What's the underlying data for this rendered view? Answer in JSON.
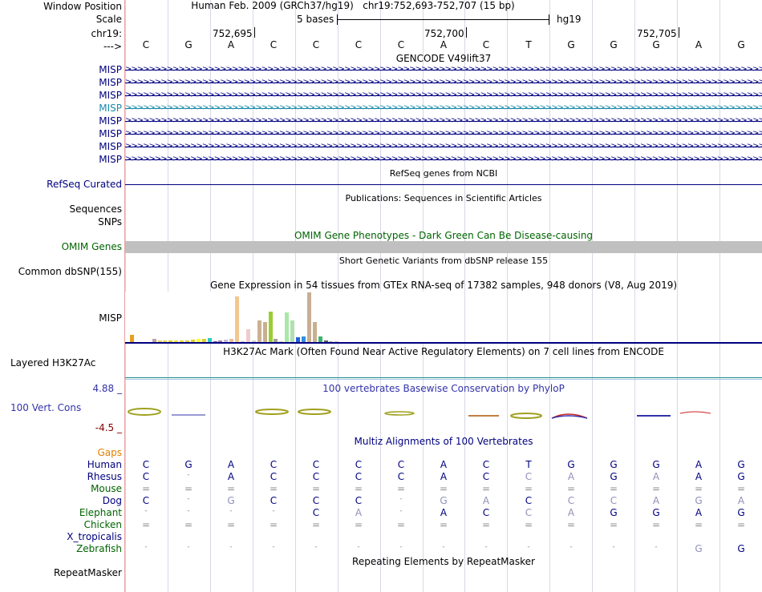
{
  "header": {
    "window_position_label": "Window Position",
    "scale_label": "Scale",
    "chrom_label": "chr19:",
    "strand_label": "--->",
    "assembly": "Human Feb. 2009 (GRCh37/hg19)",
    "position": "chr19:752,693-752,707 (15 bp)",
    "scale_text": "5 bases",
    "scale_db": "hg19",
    "ticks": [
      "752,695",
      "752,700",
      "752,705"
    ]
  },
  "bases": [
    "C",
    "G",
    "A",
    "C",
    "C",
    "C",
    "C",
    "A",
    "C",
    "T",
    "G",
    "G",
    "G",
    "A",
    "G"
  ],
  "gencode": {
    "title": "GENCODE V49lift37",
    "transcripts": [
      "MISP",
      "MISP",
      "MISP",
      "MISP",
      "MISP",
      "MISP",
      "MISP",
      "MISP"
    ]
  },
  "refseq": {
    "title": "RefSeq genes from NCBI",
    "label": "RefSeq Curated"
  },
  "publications": {
    "title": "Publications: Sequences in Scientific Articles",
    "label1": "Sequences",
    "label2": "SNPs"
  },
  "omim": {
    "title": "OMIM Gene Phenotypes - Dark Green Can Be Disease-causing",
    "label": "OMIM Genes"
  },
  "dbsnp": {
    "title": "Short Genetic Variants from dbSNP release 155",
    "label": "Common dbSNP(155)"
  },
  "gtex": {
    "title": "Gene Expression in 54 tissues from GTEx RNA-seq of 17382 samples, 948 donors (V8, Aug 2019)",
    "label": "MISP",
    "bars": [
      {
        "c": "#e7a020",
        "h": 0.17
      },
      {
        "c": "#7b6aa8",
        "h": 0.02
      },
      {
        "c": "#5a8ad0",
        "h": 0.02
      },
      {
        "c": "#b0b0b0",
        "h": 0.01
      },
      {
        "c": "#c0a0a0",
        "h": 0.08
      },
      {
        "c": "#e6d060",
        "h": 0.05
      },
      {
        "c": "#e8d44a",
        "h": 0.06
      },
      {
        "c": "#ddd030",
        "h": 0.05
      },
      {
        "c": "#f0e040",
        "h": 0.05
      },
      {
        "c": "#e8d840",
        "h": 0.05
      },
      {
        "c": "#e0d040",
        "h": 0.06
      },
      {
        "c": "#dccd3a",
        "h": 0.07
      },
      {
        "c": "#ffff33",
        "h": 0.08
      },
      {
        "c": "#e0d030",
        "h": 0.08
      },
      {
        "c": "#2ec8c8",
        "h": 0.1
      },
      {
        "c": "#6060a0",
        "h": 0.03
      },
      {
        "c": "#a080a0",
        "h": 0.05
      },
      {
        "c": "#ccbbdd",
        "h": 0.07
      },
      {
        "c": "#e8c0a0",
        "h": 0.09
      },
      {
        "c": "#f2c790",
        "h": 1.0
      },
      {
        "c": "#d0c0c0",
        "h": 0.04
      },
      {
        "c": "#eecccc",
        "h": 0.3
      },
      {
        "c": "#d0d0d0",
        "h": 0.06
      },
      {
        "c": "#ccb094",
        "h": 0.48
      },
      {
        "c": "#c8b08c",
        "h": 0.44
      },
      {
        "c": "#9acd32",
        "h": 0.68
      },
      {
        "c": "#a0a0a0",
        "h": 0.09
      },
      {
        "c": "#d8c8a8",
        "h": 0.04
      },
      {
        "c": "#a8e8a8",
        "h": 0.65
      },
      {
        "c": "#b0e0b0",
        "h": 0.48
      },
      {
        "c": "#2060e0",
        "h": 0.12
      },
      {
        "c": "#3090e0",
        "h": 0.13
      },
      {
        "c": "#c8ae94",
        "h": 1.08
      },
      {
        "c": "#c8b090",
        "h": 0.45
      },
      {
        "c": "#3cb371",
        "h": 0.13
      },
      {
        "c": "#606060",
        "h": 0.05
      },
      {
        "c": "#b0b0b0",
        "h": 0.04
      },
      {
        "c": "#e0c0c0",
        "h": 0.03
      }
    ]
  },
  "h3k27ac": {
    "title": "H3K27Ac Mark (Often Found Near Active Regulatory Elements) on 7 cell lines from ENCODE",
    "label": "Layered H3K27Ac"
  },
  "phylop": {
    "title": "100 vertebrates Basewise Conservation by PhyloP",
    "label": "100 Vert. Cons",
    "max": "4.88 _",
    "min": "-4.5 _"
  },
  "multiz": {
    "title": "Multiz Alignments of 100 Vertebrates",
    "gaps_label": "Gaps",
    "species": [
      {
        "name": "Human",
        "color": "#000080",
        "seq": [
          "C",
          "G",
          "A",
          "C",
          "C",
          "C",
          "C",
          "A",
          "C",
          "T",
          "G",
          "G",
          "G",
          "A",
          "G"
        ],
        "dim": []
      },
      {
        "name": "Rhesus",
        "color": "#000080",
        "seq": [
          "C",
          "-",
          "A",
          "C",
          "C",
          "C",
          "C",
          "A",
          "C",
          "C",
          "A",
          "G",
          "A",
          "A",
          "G"
        ],
        "dim": [
          9,
          10,
          12
        ]
      },
      {
        "name": "Mouse",
        "color": "#006400",
        "seq": [
          "=",
          "=",
          "=",
          "=",
          "=",
          "=",
          "=",
          "=",
          "=",
          "=",
          "=",
          "=",
          "=",
          "=",
          "="
        ],
        "dim": []
      },
      {
        "name": "Dog",
        "color": "#000080",
        "seq": [
          "C",
          "-",
          "G",
          "C",
          "C",
          "C",
          "-",
          "G",
          "A",
          "C",
          "C",
          "C",
          "A",
          "G",
          "A"
        ],
        "dim": [
          2,
          7,
          8,
          10,
          11,
          12,
          13,
          14
        ]
      },
      {
        "name": "Elephant",
        "color": "#006400",
        "seq": [
          "-",
          "-",
          "-",
          "-",
          "C",
          "A",
          "-",
          "A",
          "C",
          "C",
          "A",
          "G",
          "G",
          "A",
          "G"
        ],
        "dim": [
          5,
          9,
          10
        ]
      },
      {
        "name": "Chicken",
        "color": "#006400",
        "seq": [
          "=",
          "=",
          "=",
          "=",
          "=",
          "=",
          "=",
          "=",
          "=",
          "=",
          "=",
          "=",
          "=",
          "=",
          "="
        ],
        "dim": []
      },
      {
        "name": "X_tropicalis",
        "color": "#000080",
        "seq": [
          "",
          "",
          "",
          "",
          "",
          "",
          "",
          "",
          "",
          "",
          "",
          "",
          "",
          "",
          ""
        ],
        "dim": []
      },
      {
        "name": "Zebrafish",
        "color": "#006400",
        "seq": [
          "-",
          "-",
          "-",
          "-",
          "-",
          "-",
          "-",
          "-",
          "-",
          "-",
          "-",
          "-",
          "-",
          "G",
          "G"
        ],
        "dim": [
          13
        ]
      }
    ]
  },
  "repeatmasker": {
    "title": "Repeating Elements by RepeatMasker",
    "label": "RepeatMasker"
  },
  "colors": {
    "navy": "#000080",
    "green": "#006400",
    "omim_bar": "#c0c0c0",
    "teal": "#1a8a8a",
    "gaps": "#e08000",
    "phylop": "#3333aa",
    "phylo_min": "#880000"
  }
}
